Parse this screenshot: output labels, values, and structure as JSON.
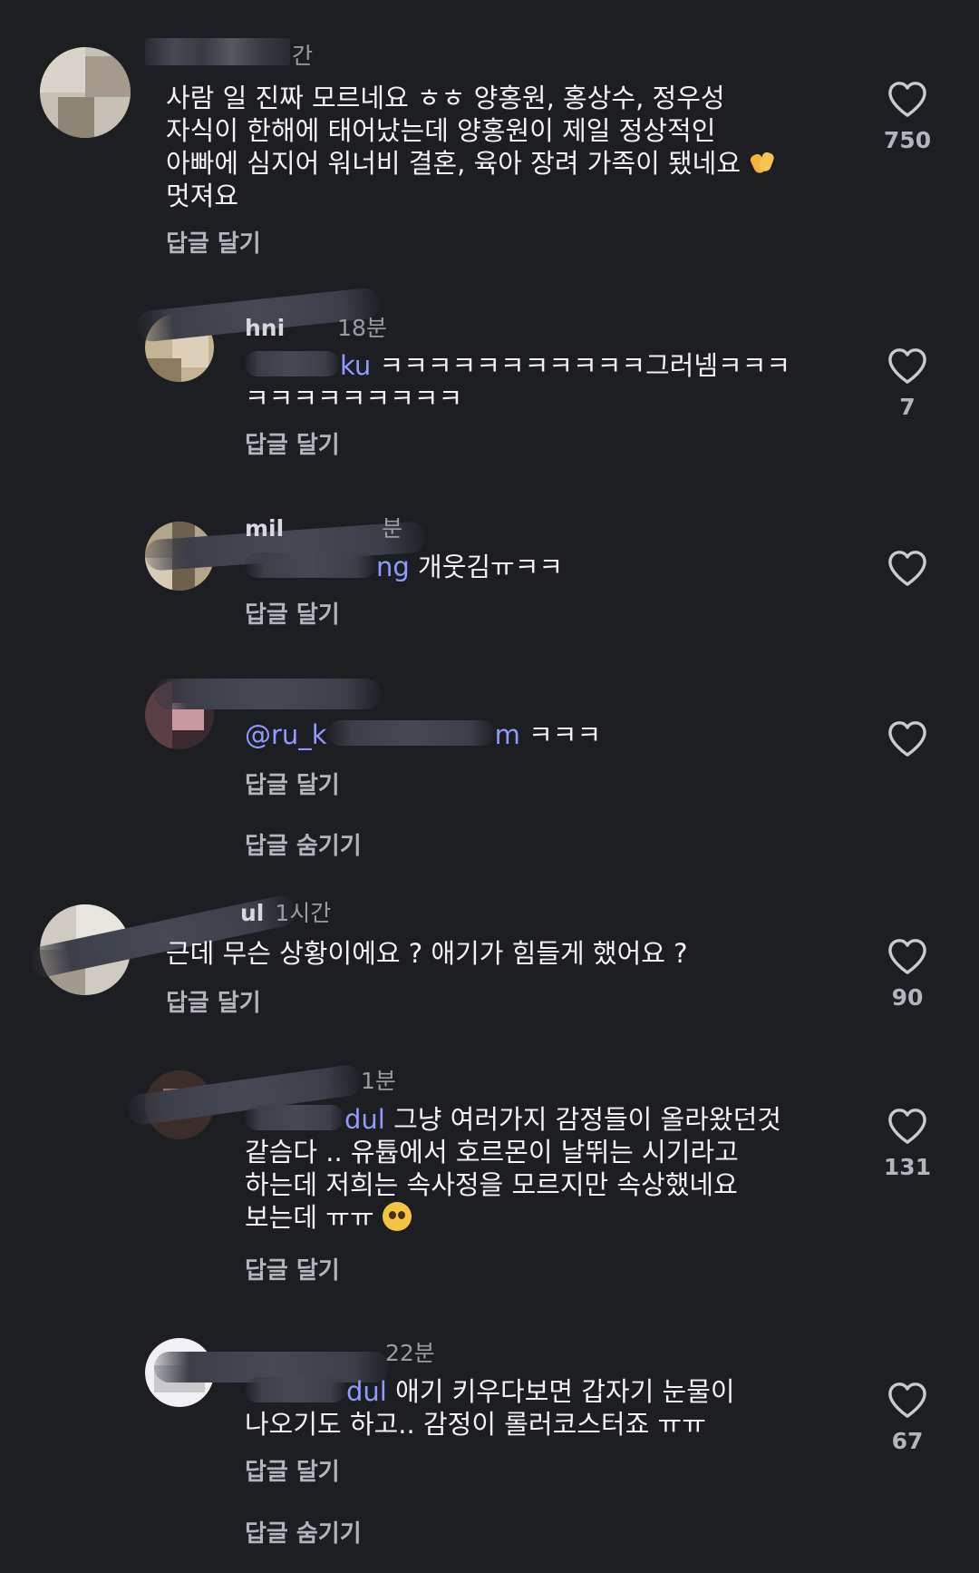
{
  "colors": {
    "background": "#1d1e22",
    "text": "#f3f3f5",
    "muted": "#9a9ba3",
    "mention": "#8f9bff",
    "icon": "#c9cad0"
  },
  "comments": [
    {
      "meta_suffix": "간",
      "text_lines": [
        "사람 일 진짜 모르네요 ㅎㅎ 양홍원, 홍상수, 정우성",
        "자식이 한해에 태어났는데 양홍원이 제일 정상적인",
        "아빠에 심지어 워너비 결혼, 육아 장려 가족이 됐네요",
        "멋져요"
      ],
      "emoji": "clapping-hands",
      "reply_label": "답글 달기",
      "like_count": "750"
    },
    {
      "meta_username": "hni",
      "meta_time": "18분",
      "mention": "ku",
      "text_line1": "ㅋㅋㅋㅋㅋㅋㅋㅋㅋㅋㅋ그러넴ㅋㅋㅋ",
      "text_line2": "ㅋㅋㅋㅋㅋㅋㅋㅋㅋ",
      "reply_label": "답글 달기",
      "like_count": "7"
    },
    {
      "meta_username": "mil",
      "meta_time": "분",
      "mention": "ng",
      "text": "개웃김ㅠㅋㅋ",
      "reply_label": "답글 달기"
    },
    {
      "mention": "@ru_k",
      "mention2": "m",
      "text": "ㅋㅋㅋ",
      "reply_label": "답글 달기",
      "hide_replies_label": "답글 숨기기"
    },
    {
      "meta_username": "ul",
      "meta_time": "1시간",
      "text": "근데 무슨 상황이에요 ? 애기가 힘들게 했어요 ?",
      "reply_label": "답글 달기",
      "like_count": "90"
    },
    {
      "meta_time": "1분",
      "mention": "dul",
      "text_lines": [
        "그냥 여러가지 감정들이 올라왔던것",
        "같슴다 .. 유튭에서 호르몬이 날뛰는 시기라고",
        "하는데 저희는 속사정을 모르지만 속상했네요",
        "보는데 ㅠㅠ"
      ],
      "emoji": "pleading-face",
      "reply_label": "답글 달기",
      "like_count": "131"
    },
    {
      "meta_time": "22분",
      "mention": "dul",
      "text_lines": [
        "애기 키우다보면 갑자기 눈물이",
        "나오기도 하고.. 감정이 롤러코스터죠 ㅠㅠ"
      ],
      "reply_label": "답글 달기",
      "like_count": "67",
      "hide_replies_label": "답글 숨기기"
    }
  ]
}
